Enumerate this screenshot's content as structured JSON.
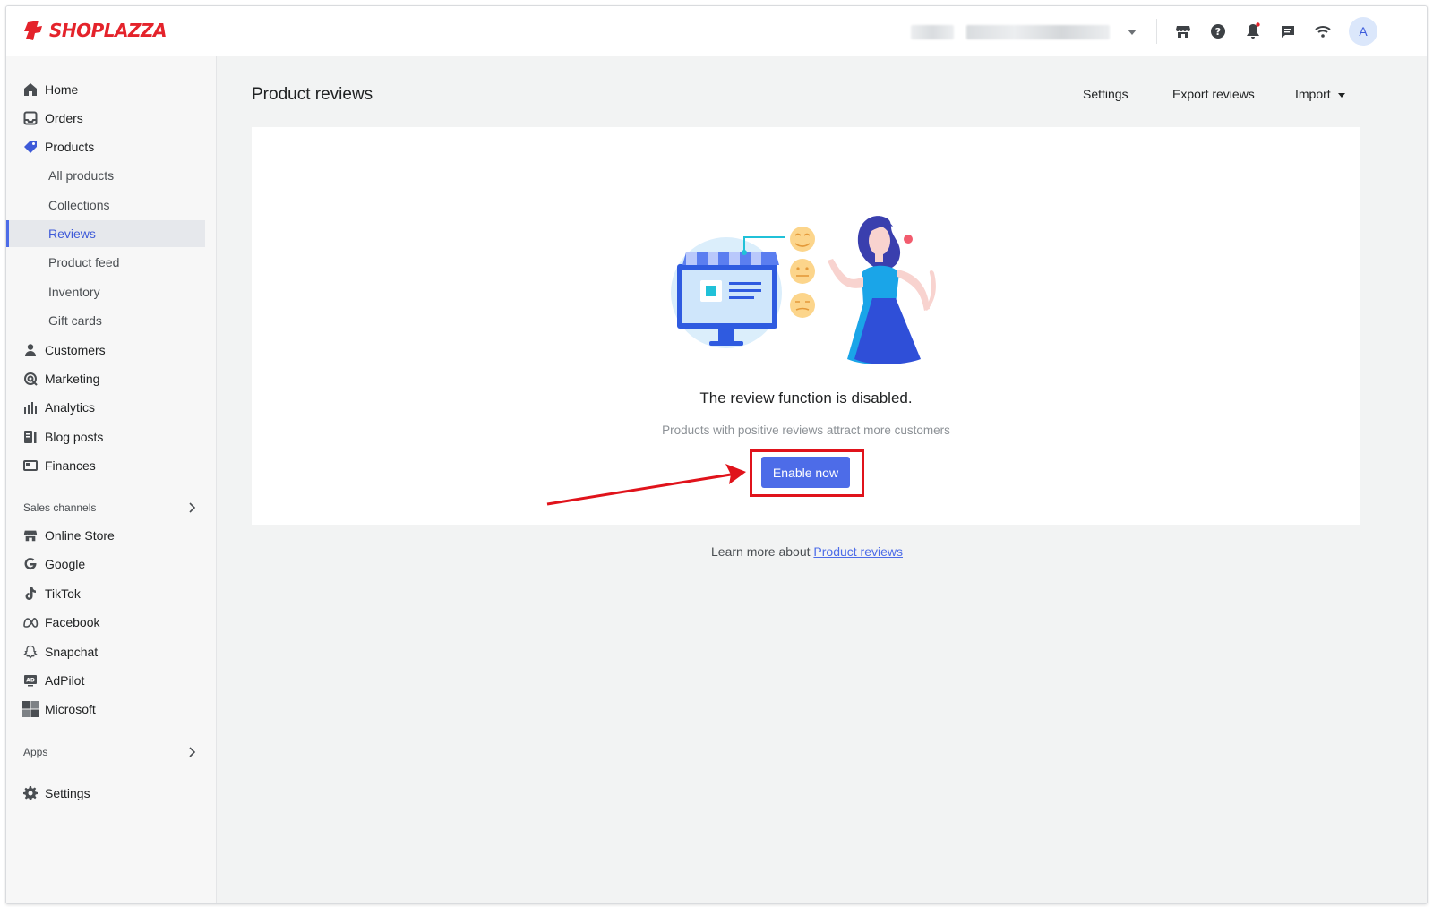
{
  "brand": {
    "name": "SHOPLAZZA",
    "accent": "#e4232b"
  },
  "topbar": {
    "store_selector_icon": "chevron-down-icon",
    "icons": [
      "storefront-icon",
      "help-icon",
      "bell-icon",
      "chat-icon",
      "wifi-icon"
    ],
    "avatar_initial": "A"
  },
  "sidebar": {
    "items": [
      {
        "label": "Home",
        "icon": "home-icon"
      },
      {
        "label": "Orders",
        "icon": "inbox-icon"
      },
      {
        "label": "Products",
        "icon": "tag-icon"
      }
    ],
    "product_subitems": [
      {
        "label": "All products"
      },
      {
        "label": "Collections"
      },
      {
        "label": "Reviews",
        "active": true
      },
      {
        "label": "Product feed"
      },
      {
        "label": "Inventory"
      },
      {
        "label": "Gift cards"
      }
    ],
    "items_after": [
      {
        "label": "Customers",
        "icon": "person-icon"
      },
      {
        "label": "Marketing",
        "icon": "target-icon"
      },
      {
        "label": "Analytics",
        "icon": "bar-chart-icon"
      },
      {
        "label": "Blog posts",
        "icon": "blog-icon"
      },
      {
        "label": "Finances",
        "icon": "finance-icon"
      }
    ],
    "sales_channels_label": "Sales channels",
    "channels": [
      {
        "label": "Online Store",
        "icon": "storefront-icon"
      },
      {
        "label": "Google",
        "icon": "google-icon"
      },
      {
        "label": "TikTok",
        "icon": "tiktok-icon"
      },
      {
        "label": "Facebook",
        "icon": "meta-icon"
      },
      {
        "label": "Snapchat",
        "icon": "snapchat-icon"
      },
      {
        "label": "AdPilot",
        "icon": "ad-icon"
      },
      {
        "label": "Microsoft",
        "icon": "microsoft-icon"
      }
    ],
    "apps_label": "Apps",
    "settings_label": "Settings"
  },
  "main": {
    "title": "Product reviews",
    "actions": {
      "settings": "Settings",
      "export": "Export reviews",
      "import": "Import"
    },
    "empty_state": {
      "title": "The review function is disabled.",
      "subtitle": "Products with positive reviews attract more customers",
      "button": "Enable now"
    },
    "learn_more_prefix": "Learn more about ",
    "learn_more_link": "Product reviews"
  },
  "colors": {
    "primary": "#4d6ce8",
    "annotation": "#e0131b"
  }
}
